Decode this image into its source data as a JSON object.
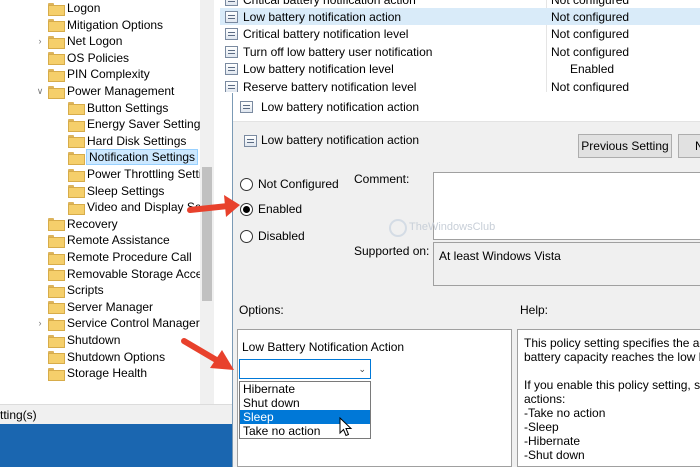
{
  "tree": {
    "items": [
      {
        "label": "Logon",
        "expandable": false
      },
      {
        "label": "Mitigation Options",
        "expandable": false
      },
      {
        "label": "Net Logon",
        "expandable": true
      },
      {
        "label": "OS Policies",
        "expandable": false
      },
      {
        "label": "PIN Complexity",
        "expandable": false
      },
      {
        "label": "Power Management",
        "expandable": true,
        "expanded": true
      },
      {
        "label": "Button Settings",
        "expandable": false
      },
      {
        "label": "Energy Saver Settings",
        "expandable": false
      },
      {
        "label": "Hard Disk Settings",
        "expandable": false
      },
      {
        "label": "Notification Settings",
        "expandable": false,
        "selected": true
      },
      {
        "label": "Power Throttling Settin",
        "expandable": false
      },
      {
        "label": "Sleep Settings",
        "expandable": false
      },
      {
        "label": "Video and Display Setti",
        "expandable": false
      },
      {
        "label": "Recovery",
        "expandable": false
      },
      {
        "label": "Remote Assistance",
        "expandable": false
      },
      {
        "label": "Remote Procedure Call",
        "expandable": false
      },
      {
        "label": "Removable Storage Access",
        "expandable": false
      },
      {
        "label": "Scripts",
        "expandable": false
      },
      {
        "label": "Server Manager",
        "expandable": false
      },
      {
        "label": "Service Control Manager S",
        "expandable": true
      },
      {
        "label": "Shutdown",
        "expandable": false
      },
      {
        "label": "Shutdown Options",
        "expandable": false
      },
      {
        "label": "Storage Health",
        "expandable": false
      }
    ]
  },
  "policies": [
    {
      "name": "Critical battery notification action",
      "state": "Not configured"
    },
    {
      "name": "Low battery notification action",
      "state": "Not configured",
      "highlighted": true
    },
    {
      "name": "Critical battery notification level",
      "state": "Not configured"
    },
    {
      "name": "Turn off low battery user notification",
      "state": "Not configured"
    },
    {
      "name": "Low battery notification level",
      "state": "Enabled"
    },
    {
      "name": "Reserve battery notification level",
      "state": "Not configured"
    }
  ],
  "statusbar": {
    "text": "tting(s)"
  },
  "dialog": {
    "title": "Low battery notification action",
    "header": "Low battery notification action",
    "prev_button": "Previous Setting",
    "next_button": "N",
    "radios": [
      {
        "label": "Not Configured",
        "checked": false
      },
      {
        "label": "Enabled",
        "checked": true
      },
      {
        "label": "Disabled",
        "checked": false
      }
    ],
    "comment_label": "Comment:",
    "supported_label": "Supported on:",
    "supported_value": "At least Windows Vista",
    "watermark": "TheWindowsClub",
    "options_label": "Options:",
    "help_label": "Help:",
    "option_title": "Low Battery Notification Action",
    "dropdown": {
      "selected": "",
      "options": [
        "Hibernate",
        "Shut down",
        "Sleep",
        "Take no action"
      ],
      "highlighted_index": 2
    },
    "help_lines": [
      "This policy setting specifies the actio",
      "battery capacity reaches the low batt",
      "",
      "If you enable this policy setting, selec",
      "actions:",
      "-Take no action",
      "-Sleep",
      "-Hibernate",
      "-Shut down"
    ]
  },
  "colors": {
    "accent": "#0078d7",
    "annotation_arrow": "#e8412c",
    "selection": "#cce8ff"
  }
}
